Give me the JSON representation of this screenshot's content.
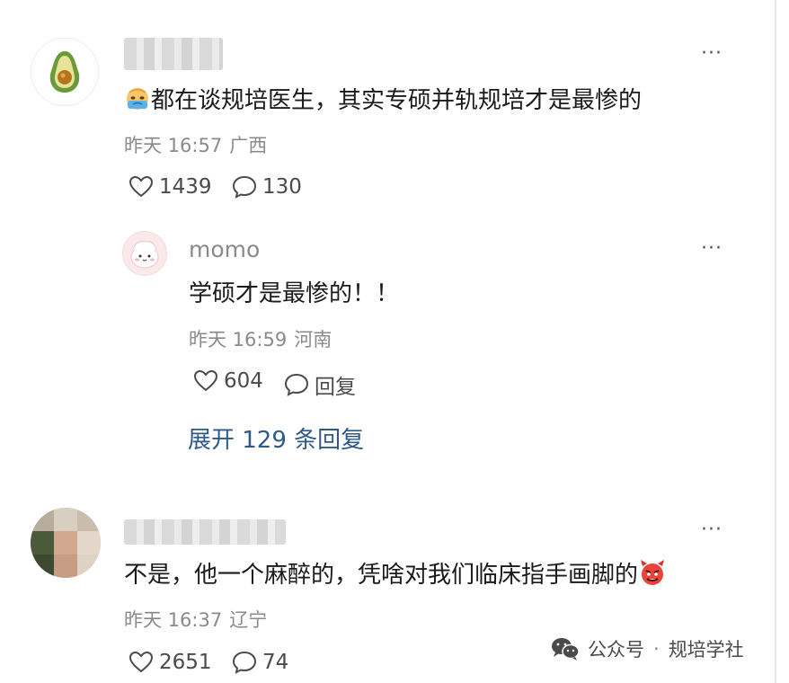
{
  "comments": [
    {
      "text": "都在谈规培医生，其实专硕并轨规培才是最惨的",
      "emoji": "crying-face-emoji",
      "time": "昨天 16:57",
      "location": "广西",
      "likes": "1439",
      "replies": "130"
    },
    {
      "username": "momo",
      "text": "学硕才是最惨的！！",
      "time": "昨天 16:59",
      "location": "河南",
      "likes": "604",
      "reply_label": "回复"
    },
    {
      "text": "不是，他一个麻醉的，凭啥对我们临床指手画脚的",
      "emoji": "angry-devil-emoji",
      "time": "昨天 16:37",
      "location": "辽宁",
      "likes": "2651",
      "replies": "74"
    }
  ],
  "expand_replies": "展开 129 条回复",
  "more_button": "···",
  "watermark": {
    "source": "公众号",
    "separator": "·",
    "account": "规培学社"
  },
  "colors": {
    "text": "#1a1a1a",
    "meta": "#8a8a8a",
    "link": "#2e5a8a"
  }
}
